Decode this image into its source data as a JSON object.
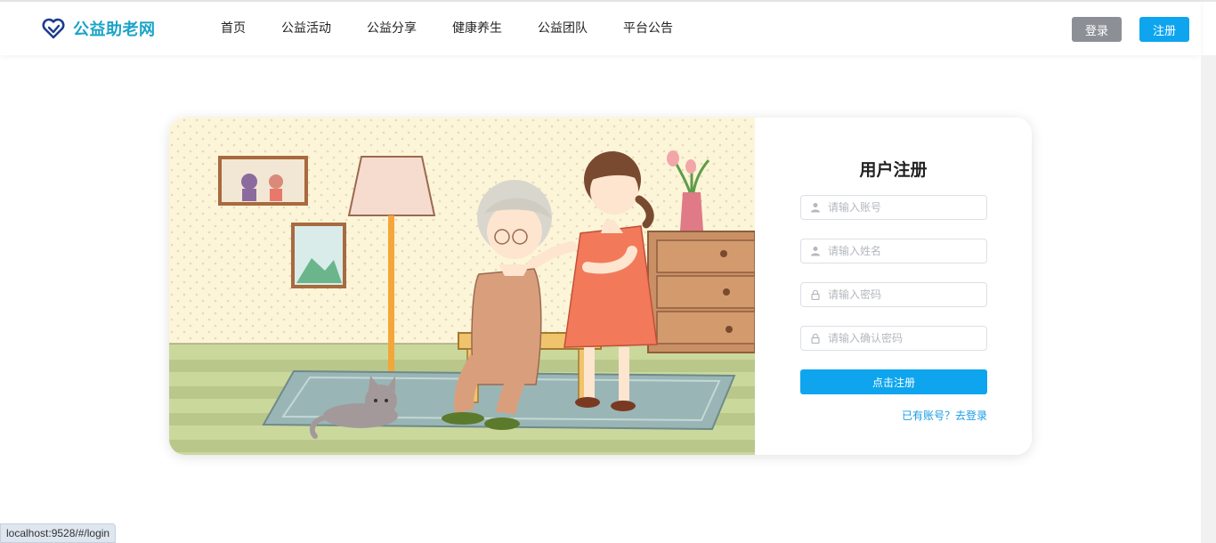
{
  "brand": {
    "name": "公益助老网",
    "color": "#1aa3c9"
  },
  "nav": {
    "items": [
      {
        "label": "首页"
      },
      {
        "label": "公益活动"
      },
      {
        "label": "公益分享"
      },
      {
        "label": "健康养生"
      },
      {
        "label": "公益团队"
      },
      {
        "label": "平台公告"
      }
    ]
  },
  "header": {
    "login_label": "登录",
    "register_label": "注册"
  },
  "register_form": {
    "title": "用户注册",
    "account_placeholder": "请输入账号",
    "name_placeholder": "请输入姓名",
    "password_placeholder": "请输入密码",
    "confirm_placeholder": "请输入确认密码",
    "submit_label": "点击注册",
    "login_link": "已有账号？去登录"
  },
  "status_bar": {
    "url": "localhost:9528/#/login"
  },
  "colors": {
    "accent": "#0ea5ee",
    "login_button": "#8c9096"
  }
}
